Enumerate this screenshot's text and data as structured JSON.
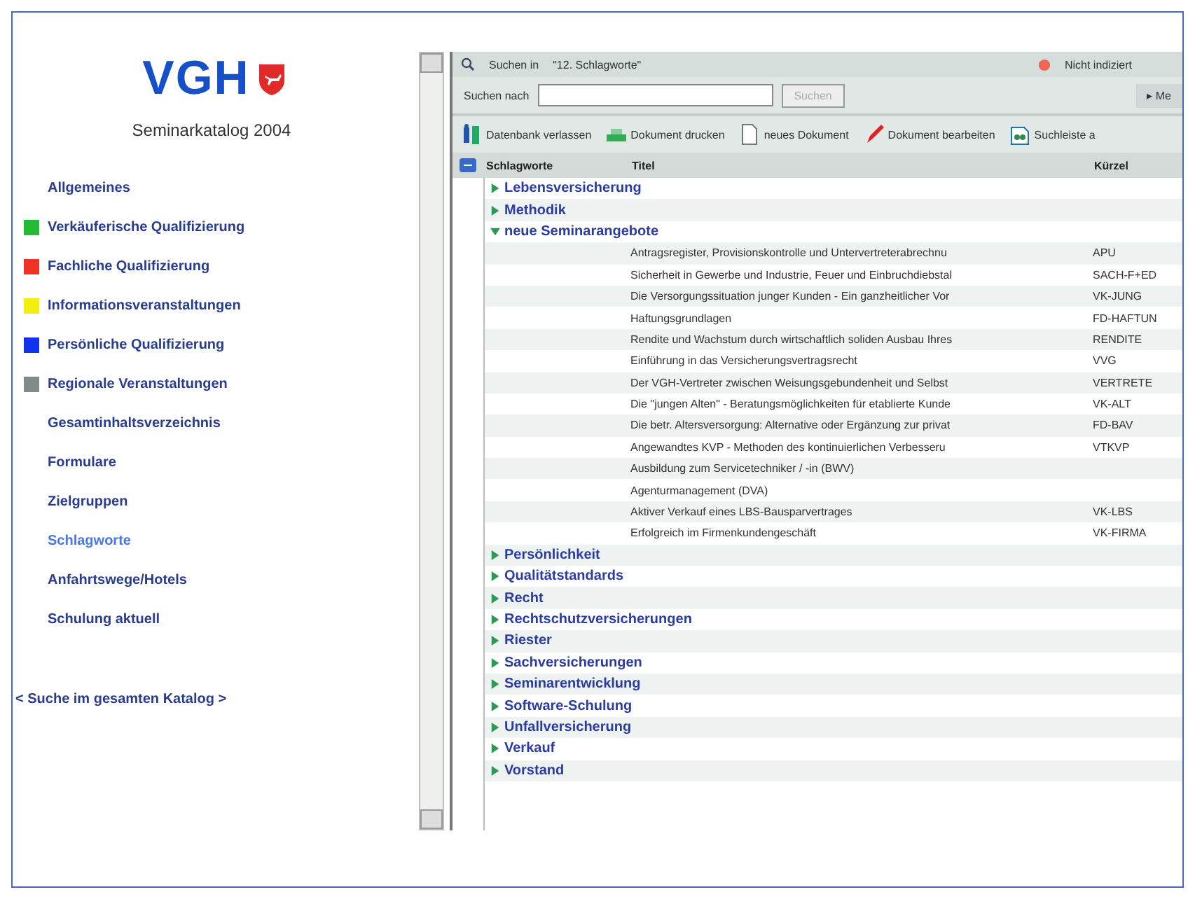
{
  "sidebar": {
    "logo": "VGH",
    "subtitle": "Seminarkatalog 2004",
    "items": [
      {
        "label": "Allgemeines",
        "selected": false
      },
      {
        "label": "Verkäuferische Qualifizierung",
        "color": "#22bb33",
        "selected": false
      },
      {
        "label": "Fachliche Qualifizierung",
        "color": "#ee3322",
        "selected": false
      },
      {
        "label": "Informationsveranstaltungen",
        "color": "#f4ee10",
        "selected": false
      },
      {
        "label": "Persönliche Qualifizierung",
        "color": "#1133ee",
        "selected": false
      },
      {
        "label": "Regionale Veranstaltungen",
        "color": "#808a88",
        "selected": false
      },
      {
        "label": "Gesamtinhaltsverzeichnis",
        "selected": false
      },
      {
        "label": "Formulare",
        "selected": false
      },
      {
        "label": "Zielgruppen",
        "selected": false
      },
      {
        "label": "Schlagworte",
        "selected": true
      },
      {
        "label": "Anfahrtswege/Hotels",
        "selected": false
      },
      {
        "label": "Schulung aktuell",
        "selected": false
      }
    ],
    "search_link": "< Suche im gesamten Katalog >"
  },
  "searchbar": {
    "label": "Suchen in",
    "scope": "\"12. Schlagworte\"",
    "status": "Nicht indiziert",
    "query_label": "Suchen nach",
    "button": "Suchen",
    "more": "▸ Me"
  },
  "toolbar": [
    "Datenbank verlassen",
    "Dokument drucken",
    "neues Dokument",
    "Dokument bearbeiten",
    "Suchleiste a"
  ],
  "table": {
    "columns": [
      "Schlagworte",
      "Titel",
      "Kürzel"
    ],
    "rows": [
      {
        "label": "Lebensversicherung",
        "expanded": false
      },
      {
        "label": "Methodik",
        "expanded": false
      },
      {
        "label": "neue Seminarangebote",
        "expanded": true,
        "children": [
          {
            "title": "Antragsregister, Provisionskontrolle und Untervertreterabrechnu",
            "code": "APU"
          },
          {
            "title": "Sicherheit in Gewerbe und Industrie, Feuer und Einbruchdiebstal",
            "code": "SACH-F+ED"
          },
          {
            "title": "Die Versorgungssituation junger Kunden - Ein ganzheitlicher Vor",
            "code": "VK-JUNG"
          },
          {
            "title": "Haftungsgrundlagen",
            "code": "FD-HAFTUN"
          },
          {
            "title": "Rendite und Wachstum durch wirtschaftlich soliden Ausbau Ihres",
            "code": "RENDITE"
          },
          {
            "title": "Einführung in das Versicherungsvertragsrecht",
            "code": "VVG"
          },
          {
            "title": "Der VGH-Vertreter zwischen Weisungsgebundenheit und Selbst",
            "code": "VERTRETE"
          },
          {
            "title": "Die \"jungen Alten\" - Beratungsmöglichkeiten für etablierte Kunde",
            "code": "VK-ALT"
          },
          {
            "title": "Die betr. Altersversorgung: Alternative oder Ergänzung zur privat",
            "code": "FD-BAV"
          },
          {
            "title": "Angewandtes KVP - Methoden des kontinuierlichen Verbesseru",
            "code": "VTKVP"
          },
          {
            "title": "Ausbildung zum Servicetechniker / -in (BWV)"
          },
          {
            "title": "Agenturmanagement (DVA)"
          },
          {
            "title": "Aktiver Verkauf eines LBS-Bausparvertrages",
            "code": "VK-LBS"
          },
          {
            "title": "Erfolgreich im Firmenkundengeschäft",
            "code": "VK-FIRMA"
          }
        ]
      },
      {
        "label": "Persönlichkeit",
        "expanded": false
      },
      {
        "label": "Qualitätstandards",
        "expanded": false
      },
      {
        "label": "Recht",
        "expanded": false
      },
      {
        "label": "Rechtschutzversicherungen",
        "expanded": false
      },
      {
        "label": "Riester",
        "expanded": false
      },
      {
        "label": "Sachversicherungen",
        "expanded": false
      },
      {
        "label": "Seminarentwicklung",
        "expanded": false
      },
      {
        "label": "Software-Schulung",
        "expanded": false
      },
      {
        "label": "Unfallversicherung",
        "expanded": false
      },
      {
        "label": "Verkauf",
        "expanded": false
      },
      {
        "label": "Vorstand",
        "expanded": false
      }
    ]
  }
}
